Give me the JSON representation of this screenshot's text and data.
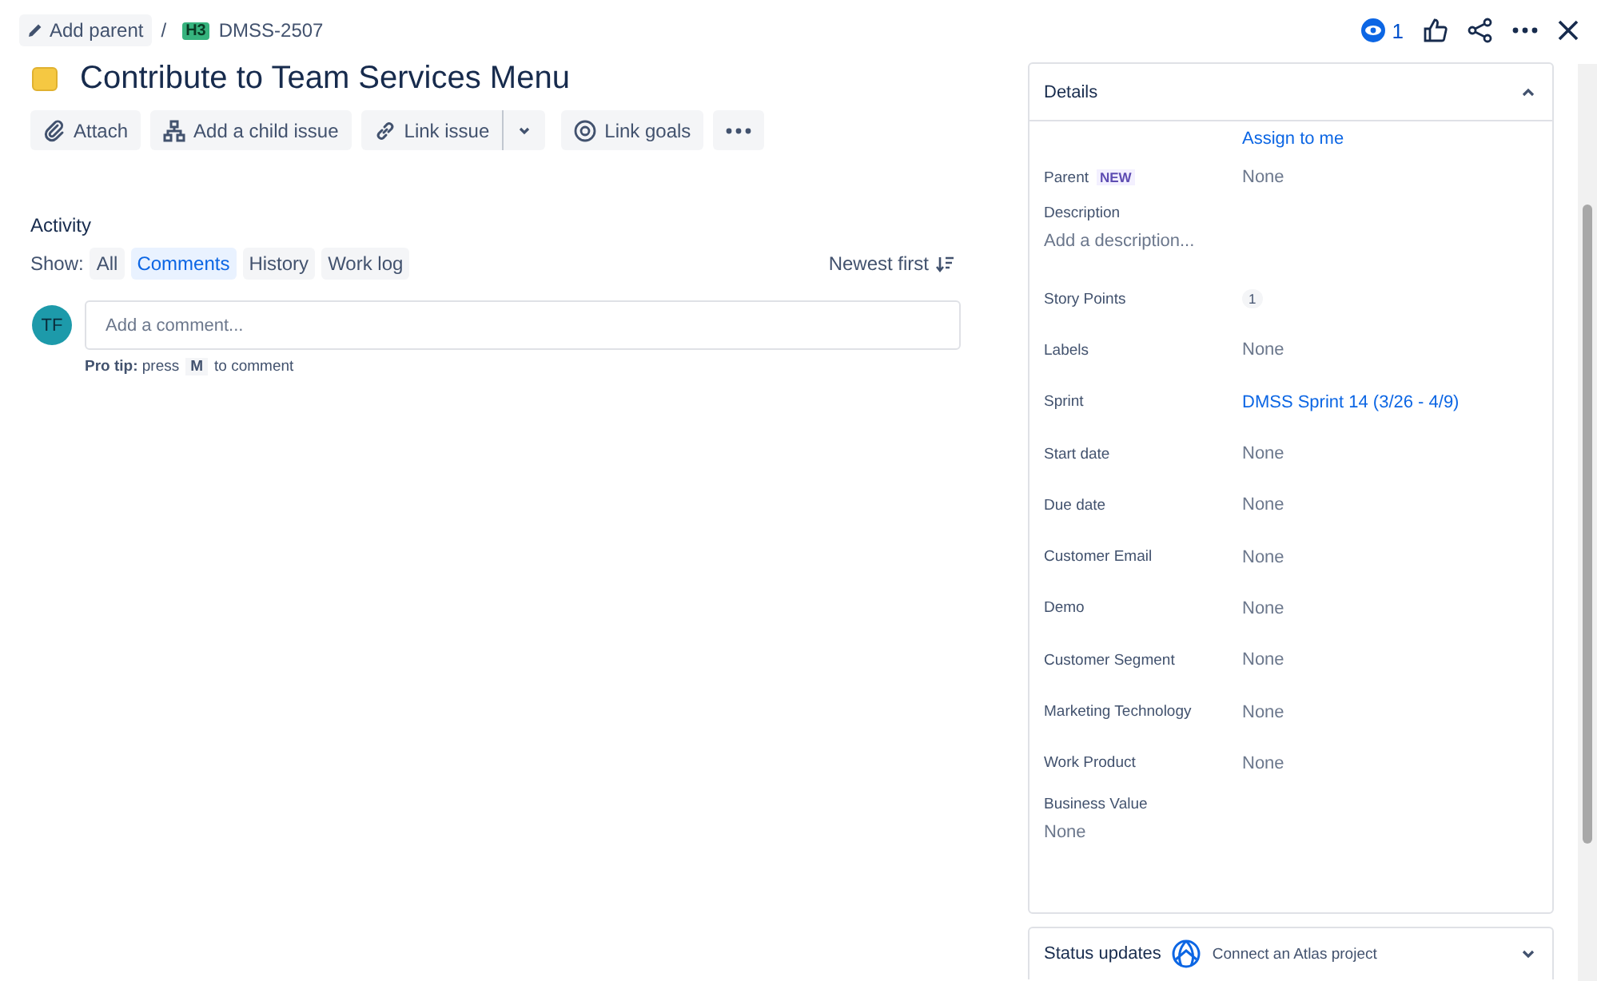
{
  "breadcrumb": {
    "add_parent": "Add parent",
    "separator": "/",
    "issue_type_badge": "H3",
    "issue_key": "DMSS-2507"
  },
  "header_actions": {
    "watch_count": "1"
  },
  "issue": {
    "title": "Contribute to Team Services Menu"
  },
  "toolbar": [
    {
      "kind": "attach",
      "label": "Attach"
    },
    {
      "kind": "child",
      "label": "Add a child issue"
    },
    {
      "kind": "link",
      "label": "Link issue"
    },
    {
      "kind": "dropdown"
    },
    {
      "kind": "goals",
      "label": "Link goals"
    },
    {
      "kind": "more"
    }
  ],
  "activity": {
    "title": "Activity",
    "show_label": "Show:",
    "filters": [
      {
        "label": "All",
        "selected": false
      },
      {
        "label": "Comments",
        "selected": true
      },
      {
        "label": "History",
        "selected": false
      },
      {
        "label": "Work log",
        "selected": false
      }
    ],
    "sort": "Newest first",
    "avatar": "TF",
    "comment_placeholder": "Add a comment...",
    "pro_tip": "**Pro tip:** press",
    "pro_tip_key": "M",
    "pro_tip_end": "to comment"
  },
  "details": {
    "title": "Details",
    "assign_link": "Assign to me",
    "fields": [
      {
        "label": "Parent",
        "badge": "NEW",
        "kind": "plain",
        "value": "None"
      },
      {
        "label": "Description",
        "kind": "description",
        "value": "Add a description..."
      },
      {
        "label": "Story Points",
        "kind": "count",
        "value": "1"
      },
      {
        "label": "Labels",
        "kind": "plain",
        "value": "None"
      },
      {
        "label": "Sprint",
        "kind": "link",
        "value": "DMSS Sprint 14 (3/26 - 4/9)"
      },
      {
        "label": "Start date",
        "kind": "plain",
        "value": "None"
      },
      {
        "label": "Due date",
        "kind": "plain",
        "value": "None"
      },
      {
        "label": "Customer Email",
        "kind": "plain",
        "value": "None"
      },
      {
        "label": "Demo",
        "kind": "plain",
        "value": "None"
      },
      {
        "label": "Customer Segment",
        "kind": "plain",
        "value": "None"
      },
      {
        "label": "Marketing Technology",
        "kind": "plain",
        "value": "None"
      },
      {
        "label": "Work Product",
        "kind": "plain",
        "value": "None"
      },
      {
        "label": "Business Value",
        "kind": "block",
        "value": "None"
      }
    ]
  },
  "status_updates": {
    "title": "Status updates",
    "connect": "Connect an Atlas project"
  }
}
